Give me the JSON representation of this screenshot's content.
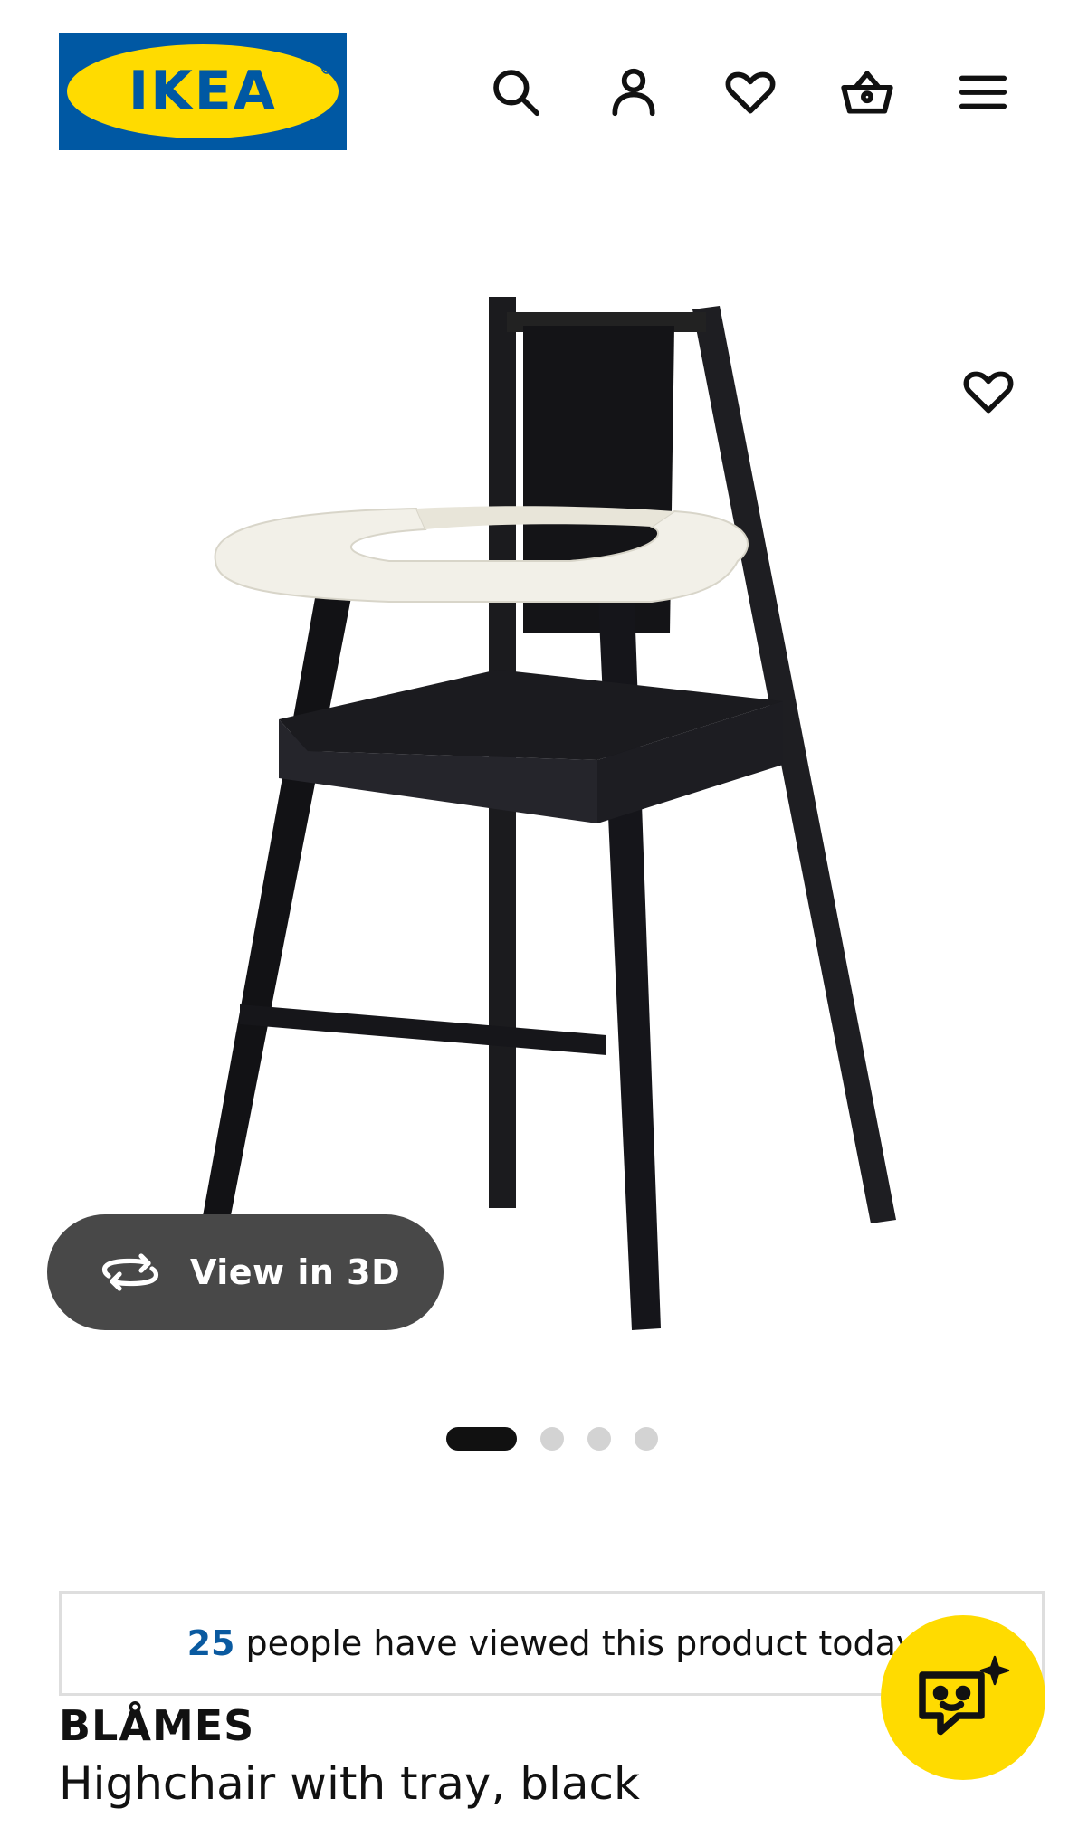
{
  "header": {
    "logo_text": "IKEA",
    "icons": [
      "search-icon",
      "profile-icon",
      "heart-icon",
      "basket-icon",
      "menu-icon"
    ]
  },
  "gallery": {
    "view_3d_label": "View in 3D",
    "slides": 4,
    "active_slide": 1
  },
  "product": {
    "viewed_count": "25",
    "viewed_text": "people have viewed this product today",
    "name": "BLÅMES",
    "description": "Highchair with tray, black"
  },
  "colors": {
    "ikea_blue": "#0058a3",
    "ikea_yellow": "#ffdb00",
    "view3d_bg": "#484848",
    "count_blue": "#0a5aa0"
  }
}
